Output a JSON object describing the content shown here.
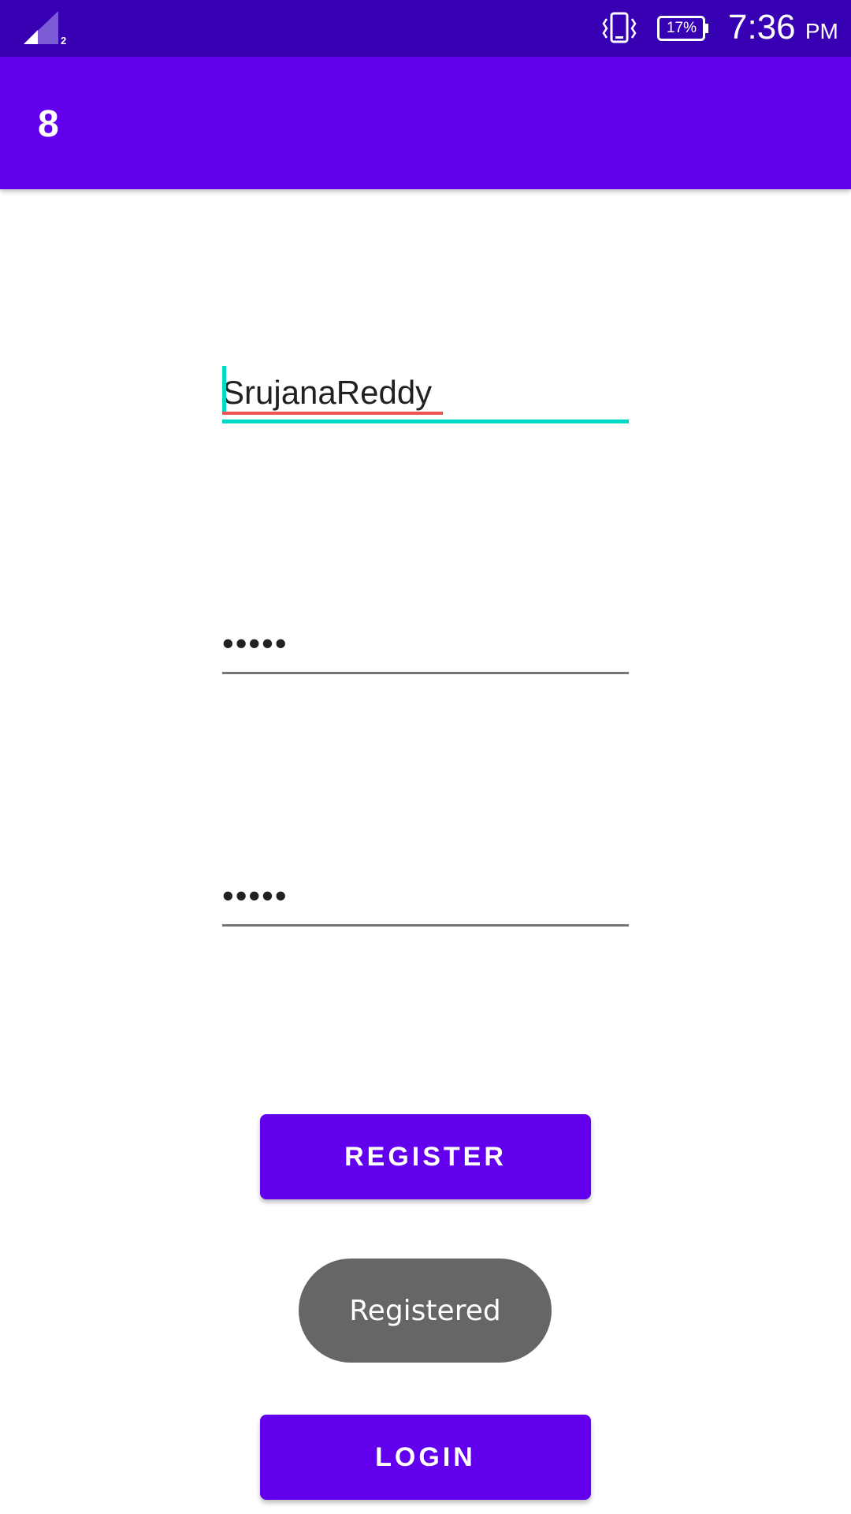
{
  "status_bar": {
    "sim_slot": "2",
    "battery_percent": "17%",
    "time": "7:36",
    "ampm": "PM",
    "icons": [
      "signal-icon",
      "vibrate-icon",
      "battery-icon"
    ]
  },
  "app_bar": {
    "title": "8"
  },
  "form": {
    "username_value": "SrujanaReddy",
    "password_value": "•••••",
    "confirm_password_value": "•••••"
  },
  "buttons": {
    "register_label": "REGISTER",
    "login_label": "LOGIN"
  },
  "toast": {
    "message": "Registered"
  },
  "colors": {
    "status_bar": "#3700b3",
    "primary": "#6200ee",
    "accent": "#03dac5",
    "toast_bg": "#666666",
    "spellcheck": "#ef5350"
  }
}
